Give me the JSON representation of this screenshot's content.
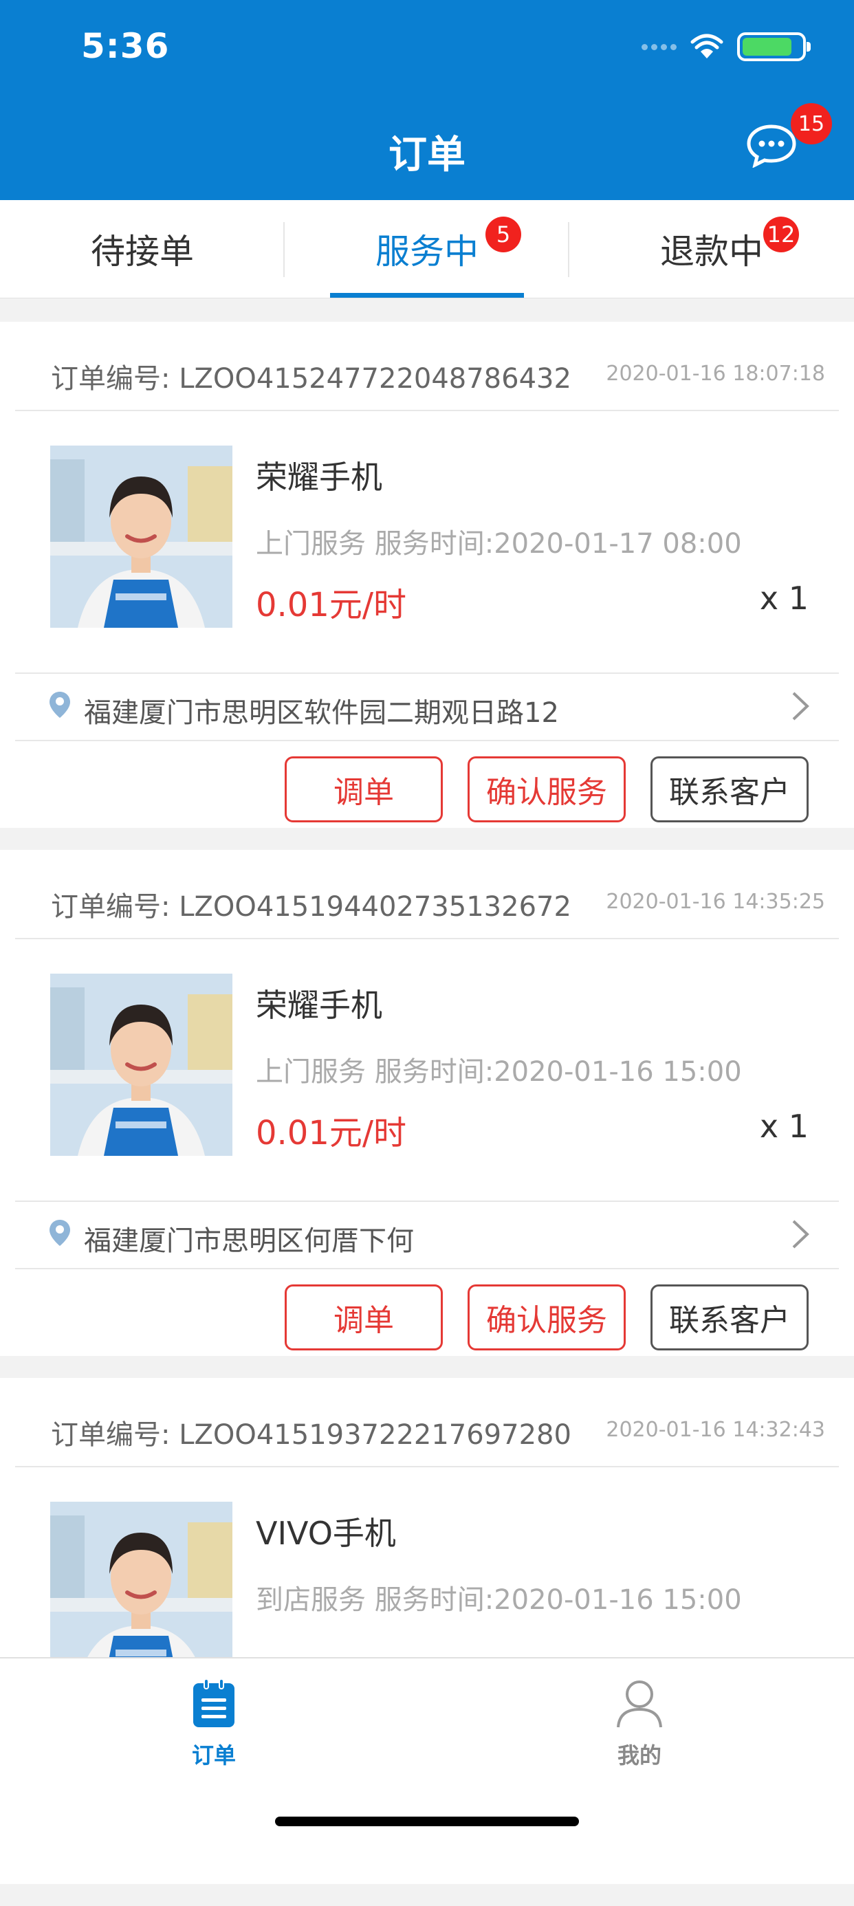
{
  "status_bar": {
    "time": "5:36",
    "battery_level": 0.85
  },
  "header": {
    "title": "订单",
    "messages": {
      "icon": "chat-bubble-icon",
      "badge": "15"
    }
  },
  "tabs": [
    {
      "label": "待接单",
      "badge": ""
    },
    {
      "label": "服务中",
      "badge": "5",
      "active": true
    },
    {
      "label": "退款中",
      "badge": "12"
    }
  ],
  "orders": [
    {
      "order_no": "订单编号: LZOO415247722048786432",
      "time": "2020-01-16 18:07:18",
      "product": "荣耀手机",
      "service": "上门服务 服务时间:2020-01-17 08:00",
      "price": "0.01元/时",
      "qty": "x 1",
      "address": "福建厦门市思明区软件园二期观日路12",
      "actions": [
        "调单",
        "确认服务",
        "联系客户"
      ]
    },
    {
      "order_no": "订单编号: LZOO415194402735132672",
      "time": "2020-01-16 14:35:25",
      "product": "荣耀手机",
      "service": "上门服务 服务时间:2020-01-16 15:00",
      "price": "0.01元/时",
      "qty": "x 1",
      "address": "福建厦门市思明区何厝下何",
      "actions": [
        "调单",
        "确认服务",
        "联系客户"
      ]
    },
    {
      "order_no": "订单编号: LZOO415193722217697280",
      "time": "2020-01-16 14:32:43",
      "product": "VIVO手机",
      "service": "到店服务 服务时间:2020-01-16 15:00",
      "price": "",
      "qty": "",
      "address": "",
      "actions": []
    }
  ],
  "bottom_nav": [
    {
      "label": "订单",
      "icon": "clipboard-icon",
      "active": true
    },
    {
      "label": "我的",
      "icon": "person-icon",
      "active": false
    }
  ],
  "colors": {
    "primary": "#0a7fd1",
    "danger": "#e53935",
    "badge": "#f1221e"
  }
}
